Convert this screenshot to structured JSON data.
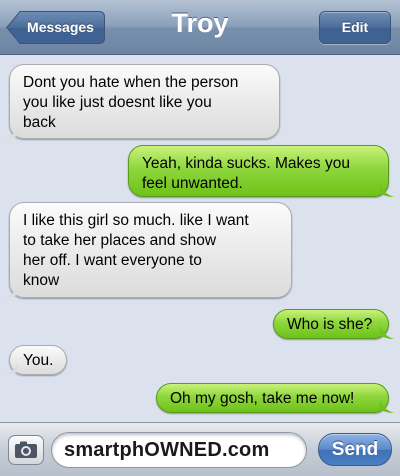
{
  "navbar": {
    "back_label": "Messages",
    "title": "Troy",
    "edit_label": "Edit"
  },
  "messages": [
    {
      "direction": "incoming",
      "text": "Dont you hate when the person\nyou like just doesnt like you\nback"
    },
    {
      "direction": "outgoing",
      "text": "Yeah, kinda sucks. Makes you\nfeel unwanted."
    },
    {
      "direction": "incoming",
      "text": "I like this girl so much. like I want\nto take her places and show\nher off. I want everyone to\nknow"
    },
    {
      "direction": "outgoing",
      "text": "Who is she?"
    },
    {
      "direction": "incoming",
      "text": "You."
    },
    {
      "direction": "outgoing",
      "text": "Oh my gosh, take me now!"
    }
  ],
  "inputbar": {
    "field_value": "smartphOWNED.com",
    "send_label": "Send",
    "camera_icon": "camera-icon"
  },
  "colors": {
    "incoming_bubble": "#e9e9e9",
    "outgoing_bubble": "#8ed63d",
    "background": "#dbe2ed",
    "send_button": "#4a7fc4"
  }
}
